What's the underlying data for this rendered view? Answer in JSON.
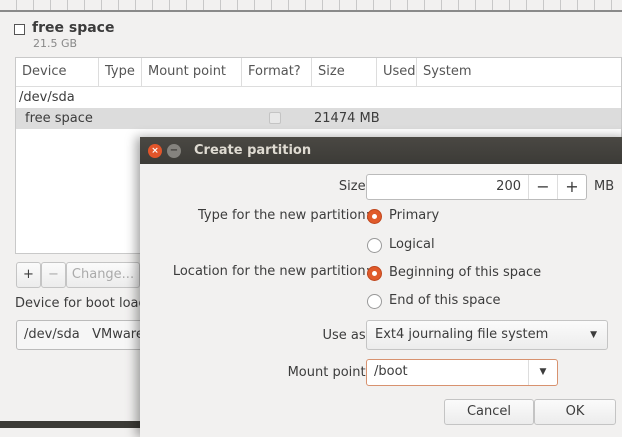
{
  "disk": {
    "label": "free space",
    "size": "21.5 GB"
  },
  "table": {
    "headers": [
      "Device",
      "Type",
      "Mount point",
      "Format?",
      "Size",
      "Used",
      "System"
    ],
    "rows": [
      {
        "device": "/dev/sda"
      },
      {
        "device": "free space",
        "size": "21474 MB"
      }
    ]
  },
  "buttons": {
    "add": "+",
    "remove": "−",
    "change": "Change..."
  },
  "boot": {
    "label": "Device for boot loader installation:",
    "value": "/dev/sda   VMware"
  },
  "dialog": {
    "title": "Create partition",
    "size_label": "Size:",
    "size_value": "200",
    "size_unit": "MB",
    "minus": "−",
    "plus": "+",
    "type_label": "Type for the new partition:",
    "type_options": [
      "Primary",
      "Logical"
    ],
    "type_selected": "Primary",
    "location_label": "Location for the new partition:",
    "location_options": [
      "Beginning of this space",
      "End of this space"
    ],
    "location_selected": "Beginning of this space",
    "use_as_label": "Use as:",
    "use_as_value": "Ext4 journaling file system",
    "mount_label": "Mount point:",
    "mount_value": "/boot",
    "cancel": "Cancel",
    "ok": "OK"
  },
  "colors": {
    "accent": "#e05a2a",
    "titlebar": "#3c3b37"
  }
}
